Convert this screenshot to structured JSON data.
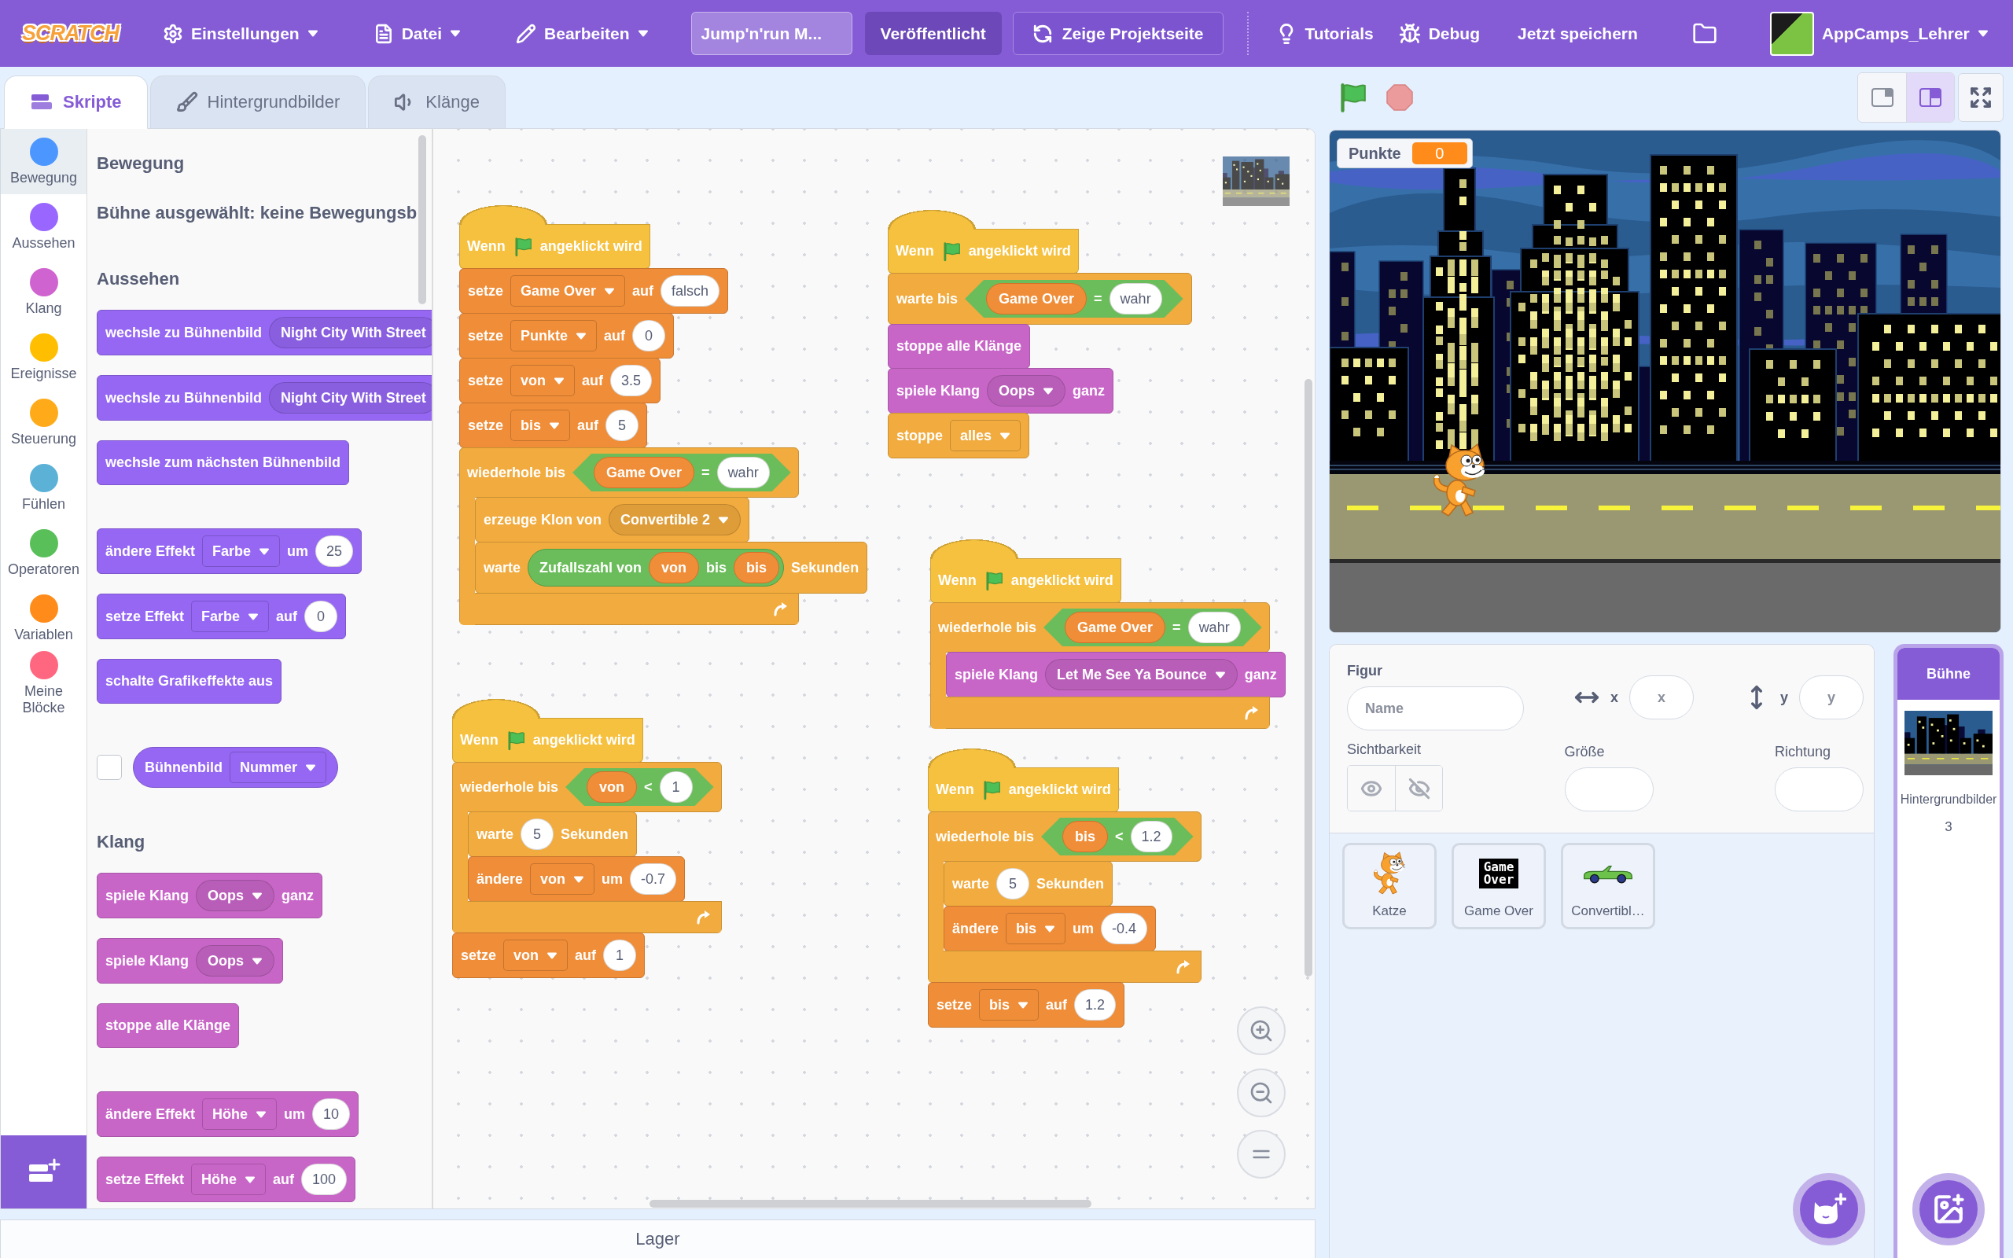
{
  "menu_bar": {
    "logo": "SCRATCH",
    "settings_menu": {
      "label": "Einstellungen"
    },
    "file_menu": {
      "label": "Datei"
    },
    "edit_menu": {
      "label": "Bearbeiten"
    },
    "project_title": {
      "value": "Jump'n'run M..."
    },
    "share_button": {
      "label": "Veröffentlicht"
    },
    "project_page_button": {
      "label": "Zeige Projektseite"
    },
    "tutorials_button": {
      "label": "Tutorials"
    },
    "debug_button": {
      "label": "Debug"
    },
    "save_button": {
      "label": "Jetzt speichern"
    },
    "account_menu": {
      "username": "AppCamps_Lehrer"
    }
  },
  "tabs": [
    {
      "kind": "code",
      "label": "Skripte",
      "selected": true
    },
    {
      "kind": "costumes",
      "label": "Hintergrundbilder",
      "selected": false
    },
    {
      "kind": "sounds",
      "label": "Klänge",
      "selected": false
    }
  ],
  "categories": [
    {
      "label": "Bewegung",
      "color": "#4c97ff",
      "selected": true
    },
    {
      "label": "Aussehen",
      "color": "#9966ff",
      "selected": false
    },
    {
      "label": "Klang",
      "color": "#cf63cf",
      "selected": false
    },
    {
      "label": "Ereignisse",
      "color": "#ffbf00",
      "selected": false
    },
    {
      "label": "Steuerung",
      "color": "#ffab19",
      "selected": false
    },
    {
      "label": "Fühlen",
      "color": "#5cb1d6",
      "selected": false
    },
    {
      "label": "Operatoren",
      "color": "#59c059",
      "selected": false
    },
    {
      "label": "Variablen",
      "color": "#ff8c1a",
      "selected": false
    },
    {
      "label": "Meine Blöcke",
      "color": "#ff6680",
      "selected": false
    }
  ],
  "palette": {
    "sections": [
      {
        "heading": "Bewegung",
        "note": "Bühne ausgewählt: keine Bewegungsb"
      },
      {
        "heading": "Aussehen",
        "groups": [
          [
            {
              "kind": "stack",
              "color": "#9567f3",
              "parts": [
                {
                  "kind": "label",
                  "text": "wechsle zu Bühnenbild"
                },
                {
                  "kind": "menu",
                  "text": "Night City With Street",
                  "caret": false
                }
              ]
            },
            {
              "kind": "stack",
              "color": "#9567f3",
              "parts": [
                {
                  "kind": "label",
                  "text": "wechsle zu Bühnenbild"
                },
                {
                  "kind": "menu",
                  "text": "Night City With Street",
                  "caret": false
                }
              ]
            },
            {
              "kind": "stack",
              "color": "#9567f3",
              "parts": [
                {
                  "kind": "label",
                  "text": "wechsle zum nächsten Bühnenbild"
                }
              ]
            }
          ],
          [
            {
              "kind": "stack",
              "color": "#9567f3",
              "parts": [
                {
                  "kind": "label",
                  "text": "ändere Effekt"
                },
                {
                  "kind": "dropdown",
                  "text": "Farbe"
                },
                {
                  "kind": "label",
                  "text": "um"
                },
                {
                  "kind": "input",
                  "text": "25"
                }
              ]
            },
            {
              "kind": "stack",
              "color": "#9567f3",
              "parts": [
                {
                  "kind": "label",
                  "text": "setze Effekt"
                },
                {
                  "kind": "dropdown",
                  "text": "Farbe"
                },
                {
                  "kind": "label",
                  "text": "auf"
                },
                {
                  "kind": "input",
                  "text": "0"
                }
              ]
            },
            {
              "kind": "stack",
              "color": "#9567f3",
              "parts": [
                {
                  "kind": "label",
                  "text": "schalte Grafikeffekte aus"
                }
              ]
            }
          ],
          [
            {
              "kind": "round",
              "color": "#9567f3",
              "checked": false,
              "parts": [
                {
                  "kind": "label",
                  "text": "Bühnenbild"
                },
                {
                  "kind": "dropdown",
                  "text": "Nummer"
                }
              ]
            }
          ]
        ]
      },
      {
        "heading": "Klang",
        "groups": [
          [
            {
              "kind": "stack",
              "color": "#c866c8",
              "parts": [
                {
                  "kind": "label",
                  "text": "spiele Klang"
                },
                {
                  "kind": "menu",
                  "text": "Oops"
                },
                {
                  "kind": "label",
                  "text": "ganz"
                }
              ]
            },
            {
              "kind": "stack",
              "color": "#c866c8",
              "parts": [
                {
                  "kind": "label",
                  "text": "spiele Klang"
                },
                {
                  "kind": "menu",
                  "text": "Oops"
                }
              ]
            },
            {
              "kind": "stack",
              "color": "#c866c8",
              "parts": [
                {
                  "kind": "label",
                  "text": "stoppe alle Klänge"
                }
              ]
            }
          ],
          [
            {
              "kind": "stack",
              "color": "#c866c8",
              "parts": [
                {
                  "kind": "label",
                  "text": "ändere Effekt"
                },
                {
                  "kind": "dropdown",
                  "text": "Höhe"
                },
                {
                  "kind": "label",
                  "text": "um"
                },
                {
                  "kind": "input",
                  "text": "10"
                }
              ]
            },
            {
              "kind": "stack",
              "color": "#c866c8",
              "parts": [
                {
                  "kind": "label",
                  "text": "setze Effekt"
                },
                {
                  "kind": "dropdown",
                  "text": "Höhe"
                },
                {
                  "kind": "label",
                  "text": "auf"
                },
                {
                  "kind": "input",
                  "text": "100"
                }
              ]
            }
          ]
        ]
      }
    ]
  },
  "scripts": [
    {
      "blocks": [
        {
          "kind": "hat",
          "color": "#f6c13f",
          "parts": [
            {
              "kind": "label",
              "text": "Wenn"
            },
            {
              "kind": "flag"
            },
            {
              "kind": "label",
              "text": "angeklickt wird"
            }
          ]
        },
        {
          "kind": "stack",
          "color": "#ef8d38",
          "parts": [
            {
              "kind": "label",
              "text": "setze"
            },
            {
              "kind": "dropdown",
              "text": "Game Over"
            },
            {
              "kind": "label",
              "text": "auf"
            },
            {
              "kind": "input",
              "text": "falsch"
            }
          ]
        },
        {
          "kind": "stack",
          "color": "#ef8d38",
          "parts": [
            {
              "kind": "label",
              "text": "setze"
            },
            {
              "kind": "dropdown",
              "text": "Punkte"
            },
            {
              "kind": "label",
              "text": "auf"
            },
            {
              "kind": "input",
              "text": "0"
            }
          ]
        },
        {
          "kind": "stack",
          "color": "#ef8d38",
          "parts": [
            {
              "kind": "label",
              "text": "setze"
            },
            {
              "kind": "dropdown",
              "text": "von"
            },
            {
              "kind": "label",
              "text": "auf"
            },
            {
              "kind": "input",
              "text": "3.5"
            }
          ]
        },
        {
          "kind": "stack",
          "color": "#ef8d38",
          "parts": [
            {
              "kind": "label",
              "text": "setze"
            },
            {
              "kind": "dropdown",
              "text": "bis"
            },
            {
              "kind": "label",
              "text": "auf"
            },
            {
              "kind": "input",
              "text": "5"
            }
          ]
        },
        {
          "kind": "c",
          "color": "#f1ab3e",
          "parts": [
            {
              "kind": "label",
              "text": "wiederhole bis"
            },
            {
              "kind": "boolean",
              "parts": [
                {
                  "kind": "variable",
                  "text": "Game Over"
                },
                {
                  "kind": "label",
                  "text": "="
                },
                {
                  "kind": "input",
                  "text": "wahr"
                }
              ]
            }
          ],
          "children": [
            {
              "kind": "stack",
              "color": "#f1ab3e",
              "parts": [
                {
                  "kind": "label",
                  "text": "erzeuge Klon von"
                },
                {
                  "kind": "menu",
                  "text": "Convertible 2"
                }
              ]
            },
            {
              "kind": "stack",
              "color": "#f1ab3e",
              "parts": [
                {
                  "kind": "label",
                  "text": "warte"
                },
                {
                  "kind": "reporter",
                  "parts": [
                    {
                      "kind": "label",
                      "text": "Zufallszahl von"
                    },
                    {
                      "kind": "variable",
                      "text": "von"
                    },
                    {
                      "kind": "label",
                      "text": "bis"
                    },
                    {
                      "kind": "variable",
                      "text": "bis"
                    }
                  ]
                },
                {
                  "kind": "label",
                  "text": "Sekunden"
                }
              ]
            }
          ]
        }
      ]
    },
    {
      "blocks": [
        {
          "kind": "hat",
          "color": "#f6c13f",
          "parts": [
            {
              "kind": "label",
              "text": "Wenn"
            },
            {
              "kind": "flag"
            },
            {
              "kind": "label",
              "text": "angeklickt wird"
            }
          ]
        },
        {
          "kind": "stack",
          "color": "#f1ab3e",
          "parts": [
            {
              "kind": "label",
              "text": "warte bis"
            },
            {
              "kind": "boolean",
              "parts": [
                {
                  "kind": "variable",
                  "text": "Game Over"
                },
                {
                  "kind": "label",
                  "text": "="
                },
                {
                  "kind": "input",
                  "text": "wahr"
                }
              ]
            }
          ]
        },
        {
          "kind": "stack",
          "color": "#c866c8",
          "parts": [
            {
              "kind": "label",
              "text": "stoppe alle Klänge"
            }
          ]
        },
        {
          "kind": "stack",
          "color": "#c866c8",
          "parts": [
            {
              "kind": "label",
              "text": "spiele Klang"
            },
            {
              "kind": "menu",
              "text": "Oops"
            },
            {
              "kind": "label",
              "text": "ganz"
            }
          ]
        },
        {
          "kind": "stack",
          "color": "#f1ab3e",
          "parts": [
            {
              "kind": "label",
              "text": "stoppe"
            },
            {
              "kind": "dropdown",
              "text": "alles"
            }
          ]
        }
      ]
    },
    {
      "blocks": [
        {
          "kind": "hat",
          "color": "#f6c13f",
          "parts": [
            {
              "kind": "label",
              "text": "Wenn"
            },
            {
              "kind": "flag"
            },
            {
              "kind": "label",
              "text": "angeklickt wird"
            }
          ]
        },
        {
          "kind": "c",
          "color": "#f1ab3e",
          "parts": [
            {
              "kind": "label",
              "text": "wiederhole bis"
            },
            {
              "kind": "boolean",
              "parts": [
                {
                  "kind": "variable",
                  "text": "Game Over"
                },
                {
                  "kind": "label",
                  "text": "="
                },
                {
                  "kind": "input",
                  "text": "wahr"
                }
              ]
            }
          ],
          "children": [
            {
              "kind": "stack",
              "color": "#c866c8",
              "parts": [
                {
                  "kind": "label",
                  "text": "spiele Klang"
                },
                {
                  "kind": "menu",
                  "text": "Let Me See Ya Bounce"
                },
                {
                  "kind": "label",
                  "text": "ganz"
                }
              ]
            }
          ]
        }
      ]
    },
    {
      "blocks": [
        {
          "kind": "hat",
          "color": "#f6c13f",
          "parts": [
            {
              "kind": "label",
              "text": "Wenn"
            },
            {
              "kind": "flag"
            },
            {
              "kind": "label",
              "text": "angeklickt wird"
            }
          ]
        },
        {
          "kind": "c",
          "color": "#f1ab3e",
          "parts": [
            {
              "kind": "label",
              "text": "wiederhole bis"
            },
            {
              "kind": "boolean",
              "parts": [
                {
                  "kind": "variable",
                  "text": "von"
                },
                {
                  "kind": "label",
                  "text": "<"
                },
                {
                  "kind": "input",
                  "text": "1"
                }
              ]
            }
          ],
          "children": [
            {
              "kind": "stack",
              "color": "#f1ab3e",
              "parts": [
                {
                  "kind": "label",
                  "text": "warte"
                },
                {
                  "kind": "input",
                  "text": "5"
                },
                {
                  "kind": "label",
                  "text": "Sekunden"
                }
              ]
            },
            {
              "kind": "stack",
              "color": "#ef8d38",
              "parts": [
                {
                  "kind": "label",
                  "text": "ändere"
                },
                {
                  "kind": "dropdown",
                  "text": "von"
                },
                {
                  "kind": "label",
                  "text": "um"
                },
                {
                  "kind": "input",
                  "text": "-0.7"
                }
              ]
            }
          ]
        },
        {
          "kind": "stack",
          "color": "#ef8d38",
          "parts": [
            {
              "kind": "label",
              "text": "setze"
            },
            {
              "kind": "dropdown",
              "text": "von"
            },
            {
              "kind": "label",
              "text": "auf"
            },
            {
              "kind": "input",
              "text": "1"
            }
          ]
        }
      ]
    },
    {
      "blocks": [
        {
          "kind": "hat",
          "color": "#f6c13f",
          "parts": [
            {
              "kind": "label",
              "text": "Wenn"
            },
            {
              "kind": "flag"
            },
            {
              "kind": "label",
              "text": "angeklickt wird"
            }
          ]
        },
        {
          "kind": "c",
          "color": "#f1ab3e",
          "parts": [
            {
              "kind": "label",
              "text": "wiederhole bis"
            },
            {
              "kind": "boolean",
              "parts": [
                {
                  "kind": "variable",
                  "text": "bis"
                },
                {
                  "kind": "label",
                  "text": "<"
                },
                {
                  "kind": "input",
                  "text": "1.2"
                }
              ]
            }
          ],
          "children": [
            {
              "kind": "stack",
              "color": "#f1ab3e",
              "parts": [
                {
                  "kind": "label",
                  "text": "warte"
                },
                {
                  "kind": "input",
                  "text": "5"
                },
                {
                  "kind": "label",
                  "text": "Sekunden"
                }
              ]
            },
            {
              "kind": "stack",
              "color": "#ef8d38",
              "parts": [
                {
                  "kind": "label",
                  "text": "ändere"
                },
                {
                  "kind": "dropdown",
                  "text": "bis"
                },
                {
                  "kind": "label",
                  "text": "um"
                },
                {
                  "kind": "input",
                  "text": "-0.4"
                }
              ]
            }
          ]
        },
        {
          "kind": "stack",
          "color": "#ef8d38",
          "parts": [
            {
              "kind": "label",
              "text": "setze"
            },
            {
              "kind": "dropdown",
              "text": "bis"
            },
            {
              "kind": "label",
              "text": "auf"
            },
            {
              "kind": "input",
              "text": "1.2"
            }
          ]
        }
      ]
    }
  ],
  "backpack": {
    "label": "Lager"
  },
  "stage_size_buttons": [
    {
      "kind": "small",
      "selected": false
    },
    {
      "kind": "normal",
      "selected": true
    }
  ],
  "stage": {
    "monitors": [
      {
        "label": "Punkte",
        "value": "0"
      }
    ]
  },
  "sprite_info": {
    "heading": "Figur",
    "name_field": {
      "placeholder": "Name"
    },
    "x_field": {
      "label": "x",
      "placeholder": "x"
    },
    "y_field": {
      "label": "y",
      "placeholder": "y"
    },
    "visibility": {
      "label": "Sichtbarkeit"
    },
    "size_field": {
      "label": "Größe"
    },
    "direction_field": {
      "label": "Richtung"
    }
  },
  "sprites": [
    {
      "name": "Katze",
      "kind": "cat",
      "selected": false
    },
    {
      "name": "Game Over",
      "kind": "text",
      "costume_text": "Game Over",
      "selected": false
    },
    {
      "name": "Convertibl…",
      "kind": "car",
      "selected": false
    }
  ],
  "stage_target": {
    "label": "Bühne",
    "selected": true,
    "backdrops_label": "Hintergrundbilder",
    "backdrop_count": "3"
  }
}
